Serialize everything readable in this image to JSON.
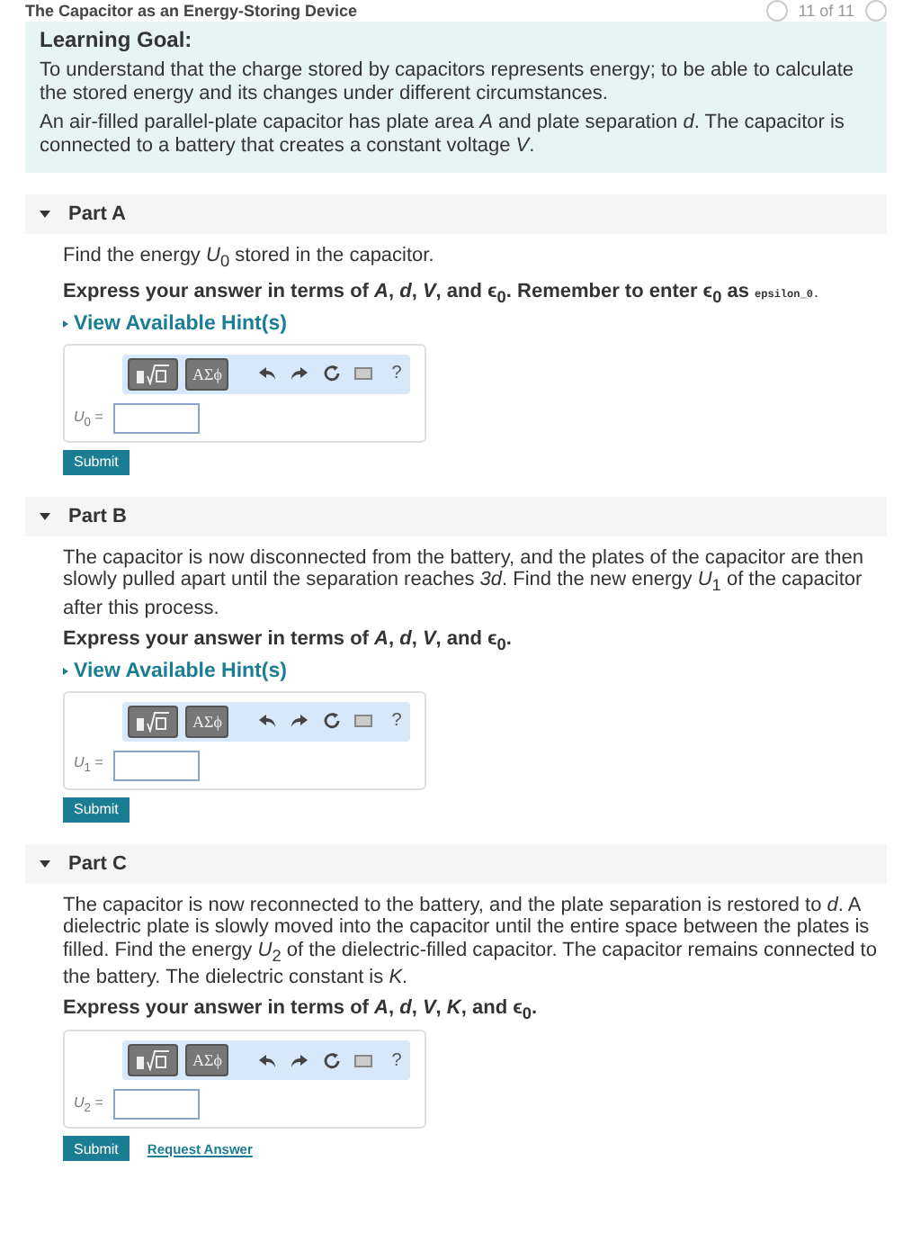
{
  "header": {
    "title": "The Capacitor as an Energy-Storing Device",
    "counter": "11 of 11"
  },
  "learning_goal": {
    "heading": "Learning Goal:",
    "paragraphs": [
      "To understand that the charge stored by capacitors represents energy; to be able to calculate the stored energy and its changes under different circumstances.",
      "An air-filled parallel-plate capacitor has plate area *A* and plate separation *d*. The capacitor is connected to a battery that creates a constant voltage *V*."
    ]
  },
  "parts": [
    {
      "title": "Part A",
      "expanded": true,
      "text": "Find the energy *U*$_{0}$ stored in the capacitor.",
      "instruction": "Express your answer in terms of *A*, *d*, *V*, and ϵ$_{0}$. Remember to enter ϵ$_{0}$ as",
      "code": "epsilon_0.",
      "hint": "View Available Hint(s)",
      "palette": [
        "ΑΣϕ",
        "?"
      ],
      "answer_label": "*U*$_{0}$ =",
      "buttons": [
        {
          "kind": "primary",
          "label": "Submit"
        }
      ]
    },
    {
      "title": "Part B",
      "expanded": true,
      "text": "The capacitor is now disconnected from the battery, and the plates of the capacitor are then slowly pulled apart until the separation reaches *3d*. Find the new energy *U*$_{1}$ of the capacitor after this process.",
      "instruction": "Express your answer in terms of *A*, *d*, *V*, and ϵ$_{0}$.",
      "hint": "View Available Hint(s)",
      "palette": [
        "ΑΣϕ",
        "?"
      ],
      "answer_label": "*U*$_{1}$ =",
      "buttons": [
        {
          "kind": "primary",
          "label": "Submit"
        }
      ]
    },
    {
      "title": "Part C",
      "expanded": true,
      "text": "The capacitor is now reconnected to the battery, and the plate separation is restored to *d*. A dielectric plate is slowly moved into the capacitor until the entire space between the plates is filled. Find the energy *U*$_{2}$ of the dielectric-filled capacitor. The capacitor remains connected to the battery. The dielectric constant is *K*.",
      "instruction": "Express your answer in terms of *A*, *d*, *V*, *K*, and ϵ$_{0}$.",
      "palette": [
        "ΑΣϕ",
        "?"
      ],
      "answer_label": "*U*$_{2}$ =",
      "buttons": [
        {
          "kind": "primary",
          "label": "Submit"
        },
        {
          "kind": "link",
          "label": "Request Answer"
        }
      ]
    }
  ]
}
